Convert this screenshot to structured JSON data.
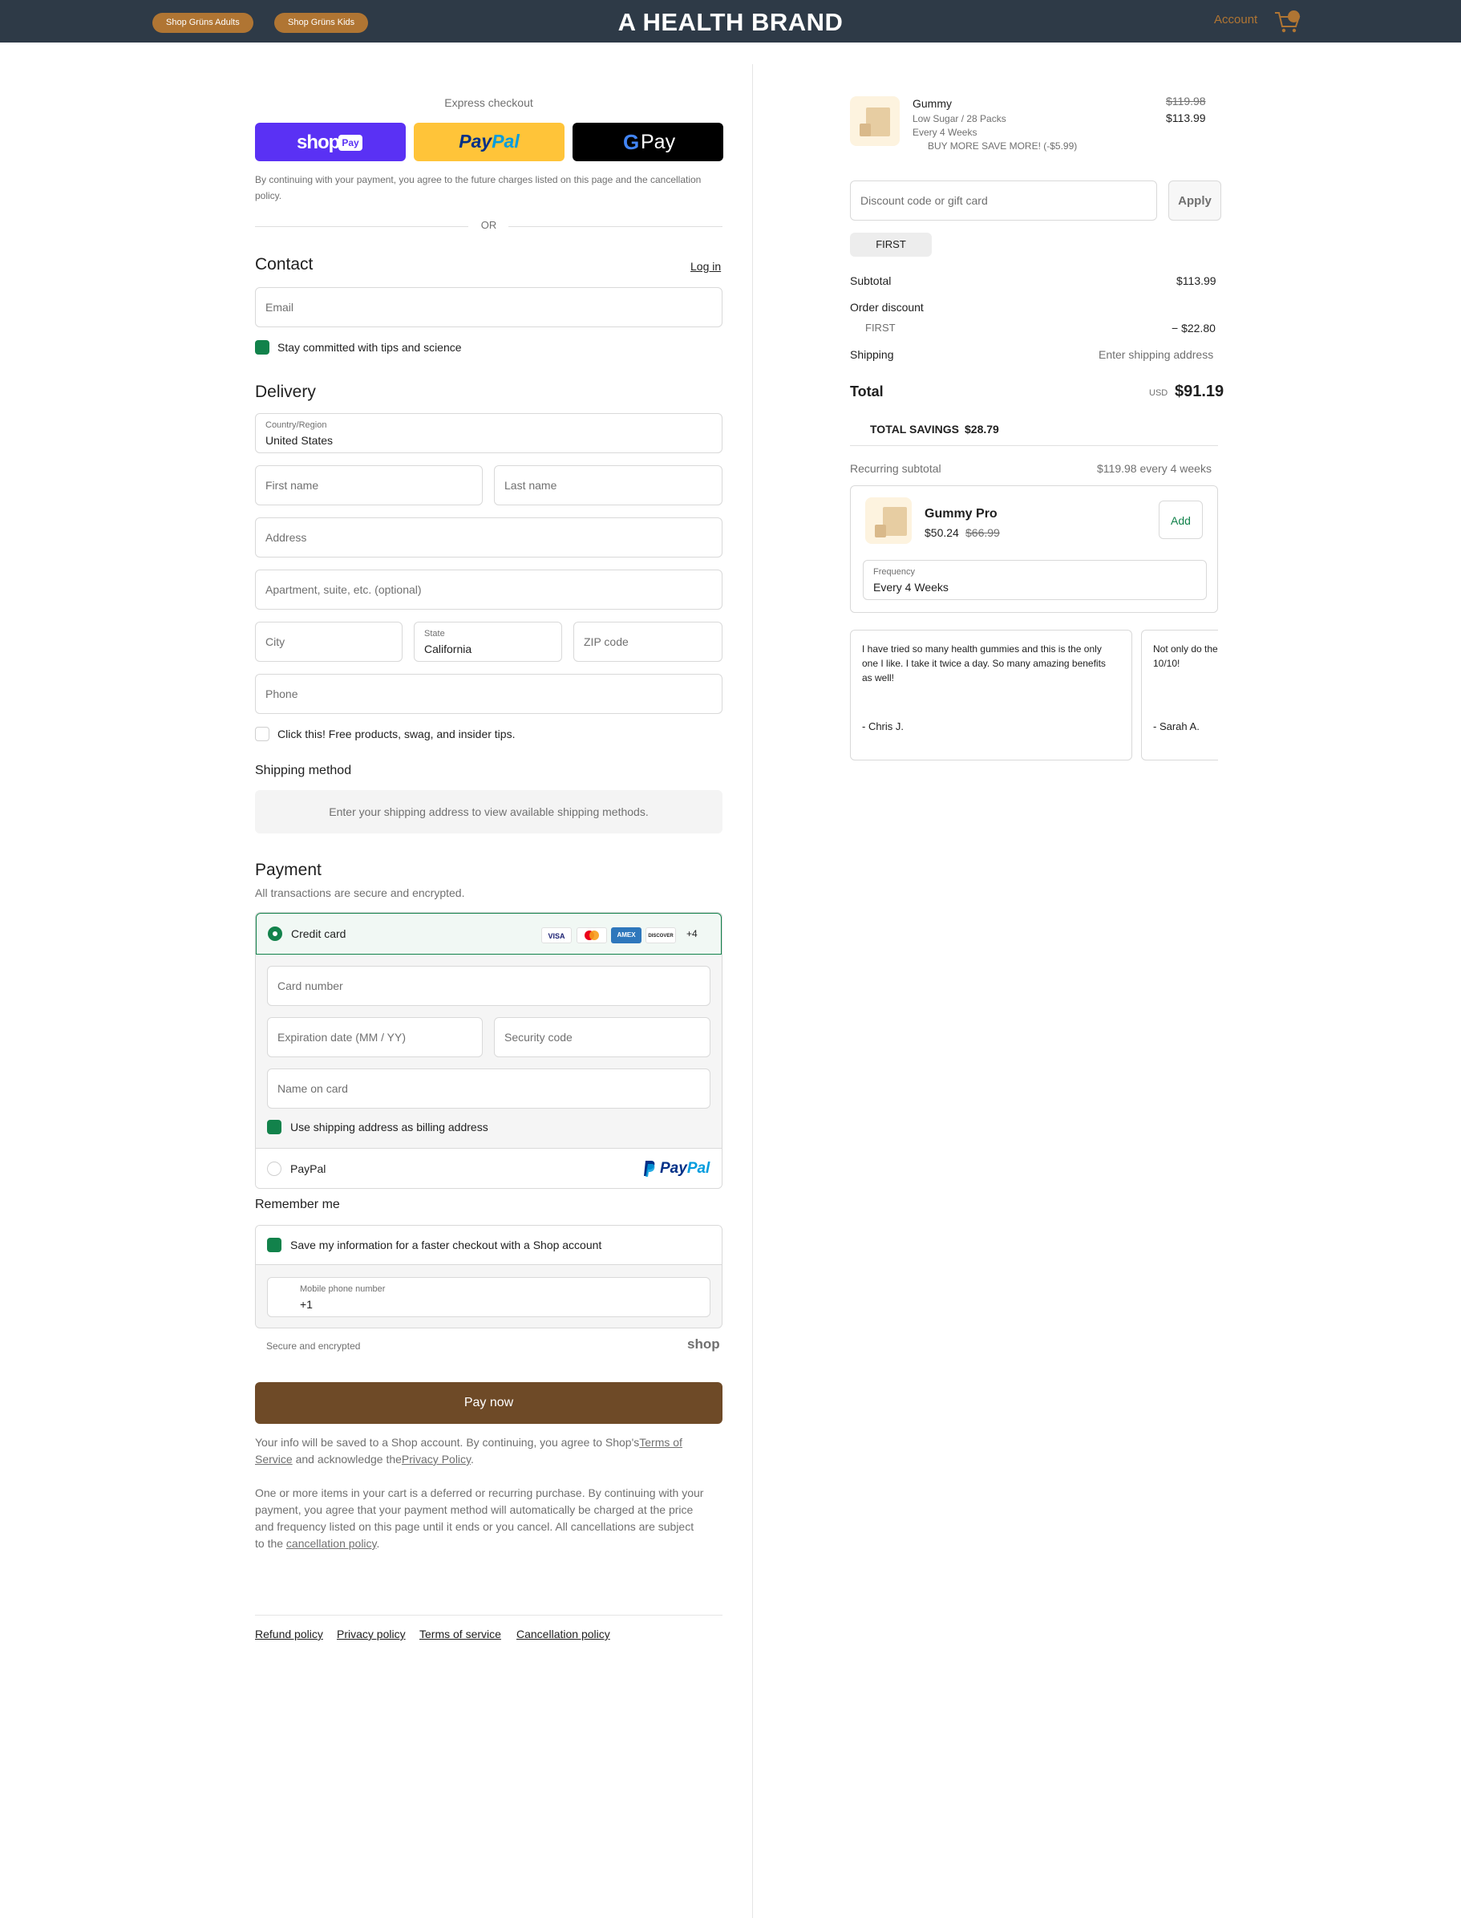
{
  "header": {
    "nav_pills": [
      "Shop Grüns Adults",
      "Shop Grüns Kids"
    ],
    "brand": "A HEALTH BRAND",
    "account_label": "Account",
    "accent": "#b07533",
    "bg": "#2e3a47"
  },
  "express": {
    "title": "Express checkout",
    "buttons": [
      {
        "name": "Shop Pay",
        "logo_text": "shop",
        "badge": "Pay"
      },
      {
        "name": "PayPal",
        "logo_a": "Pay",
        "logo_b": "Pal"
      },
      {
        "name": "Google Pay",
        "logo_g": "G",
        "logo_text": "Pay"
      }
    ],
    "legal": "By continuing with your payment, you agree to the future charges listed on this page and the cancellation policy.",
    "or_label": "OR"
  },
  "contact": {
    "heading": "Contact",
    "login_link": "Log in",
    "email_placeholder": "Email",
    "newsletter_label": "Stay committed with tips and science",
    "newsletter_checked": true
  },
  "delivery": {
    "heading": "Delivery",
    "country_label": "Country/Region",
    "country_value": "United States",
    "first_name_placeholder": "First name",
    "last_name_placeholder": "Last name",
    "address_placeholder": "Address",
    "apartment_placeholder": "Apartment, suite, etc. (optional)",
    "city_placeholder": "City",
    "state_label": "State",
    "state_value": "California",
    "zip_placeholder": "ZIP code",
    "phone_placeholder": "Phone",
    "sms_optin_label": "Click this! Free products, swag, and insider tips.",
    "sms_optin_checked": false
  },
  "shipping_method": {
    "heading": "Shipping method",
    "notice": "Enter your shipping address to view available shipping methods."
  },
  "payment": {
    "heading": "Payment",
    "subtitle": "All transactions are secure and encrypted.",
    "credit_card_label": "Credit card",
    "card_brands": [
      "VISA",
      "MC",
      "AMEX",
      "DISCOVER"
    ],
    "more_brands": "+4",
    "card_number_placeholder": "Card number",
    "expiry_placeholder": "Expiration date (MM / YY)",
    "security_placeholder": "Security code",
    "name_placeholder": "Name on card",
    "billing_same_label": "Use shipping address as billing address",
    "billing_same_checked": true,
    "paypal_label": "PayPal",
    "paypal_logo_a": "Pay",
    "paypal_logo_b": "Pal"
  },
  "remember": {
    "heading": "Remember me",
    "save_label": "Save my information for a faster checkout with a Shop account",
    "save_checked": true,
    "mobile_label": "Mobile phone number",
    "mobile_value": "+1",
    "secure_label": "Secure and encrypted",
    "shop_logo": "shop"
  },
  "pay_now_label": "Pay now",
  "legal": {
    "shop_terms_pre": "Your info will be saved to a Shop account. By continuing, you agree to Shop's",
    "terms_link_a": "Terms of",
    "terms_link_b": "Service",
    "acknowledge": " and acknowledge the",
    "privacy_link": "Privacy Policy",
    "period": ".",
    "recurring_line1": "One or more items in your cart is a deferred or recurring purchase. By continuing with your",
    "recurring_line2": "payment, you agree that your payment method will automatically be charged at the price",
    "recurring_line3": "and frequency listed on this page until it ends or you cancel. All cancellations are subject",
    "recurring_line4_pre": "to the ",
    "cancellation_link": "cancellation policy",
    "recurring_line4_post": "."
  },
  "footer_links": [
    "Refund policy",
    "Privacy policy",
    "Terms of service",
    "Cancellation policy"
  ],
  "summary": {
    "item": {
      "name": "Gummy",
      "variant": "Low Sugar / 28 Packs",
      "frequency": "Every 4 Weeks",
      "promo": "BUY MORE SAVE MORE! (-$5.99)",
      "original_price": "$119.98",
      "price": "$113.99"
    },
    "discount_placeholder": "Discount code or gift card",
    "apply_label": "Apply",
    "applied_code": "FIRST",
    "subtotal_label": "Subtotal",
    "subtotal_value": "$113.99",
    "order_discount_label": "Order discount",
    "discount_code": "FIRST",
    "discount_value": "− $22.80",
    "shipping_label": "Shipping",
    "shipping_value": "Enter shipping address",
    "total_label": "Total",
    "currency": "USD",
    "total_value": "$91.19",
    "savings_label": "TOTAL SAVINGS",
    "savings_value": "$28.79",
    "recurring_label": "Recurring subtotal",
    "recurring_value": "$119.98 every 4 weeks"
  },
  "upsell": {
    "name": "Gummy Pro",
    "price": "$50.24",
    "original_price": "$66.99",
    "add_label": "Add",
    "frequency_label": "Frequency",
    "frequency_value": "Every 4 Weeks"
  },
  "reviews": [
    {
      "lines": [
        "I have tried so many health gummies and this is the only",
        "one I like. I take it twice a day. So many amazing benefits",
        "as well!"
      ],
      "author": "- Chris J."
    },
    {
      "lines": [
        "Not only do they taste great, they work!",
        "10/10!"
      ],
      "author": "- Sarah A."
    }
  ]
}
